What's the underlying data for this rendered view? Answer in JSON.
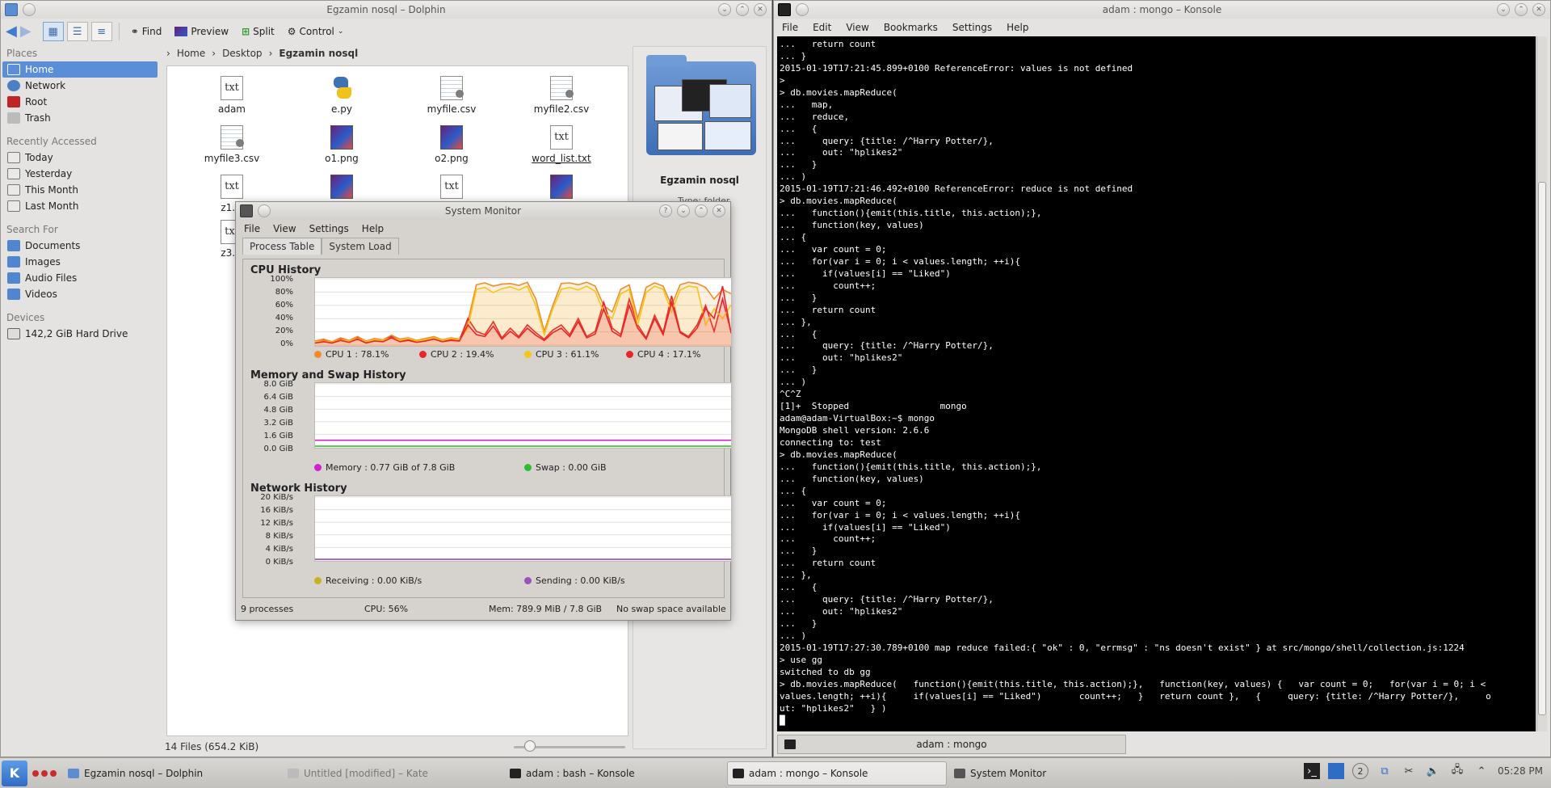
{
  "dolphin": {
    "title": "Egzamin nosql – Dolphin",
    "toolbar": {
      "find": "Find",
      "preview": "Preview",
      "split": "Split",
      "control": "Control"
    },
    "places_header": "Places",
    "places": [
      "Home",
      "Network",
      "Root",
      "Trash"
    ],
    "recent_header": "Recently Accessed",
    "recent": [
      "Today",
      "Yesterday",
      "This Month",
      "Last Month"
    ],
    "search_header": "Search For",
    "search": [
      "Documents",
      "Images",
      "Audio Files",
      "Videos"
    ],
    "devices_header": "Devices",
    "devices": [
      "142,2 GiB Hard Drive"
    ],
    "breadcrumb": [
      "Home",
      "Desktop",
      "Egzamin nosql"
    ],
    "files": [
      {
        "name": "adam",
        "type": "txt"
      },
      {
        "name": "e.py",
        "type": "py"
      },
      {
        "name": "myfile.csv",
        "type": "csv"
      },
      {
        "name": "myfile2.csv",
        "type": "csv"
      },
      {
        "name": "myfile3.csv",
        "type": "csv"
      },
      {
        "name": "o1.png",
        "type": "png"
      },
      {
        "name": "o2.png",
        "type": "png"
      },
      {
        "name": "word_list.txt",
        "type": "txt"
      },
      {
        "name": "z1.js",
        "type": "txt"
      },
      {
        "name": "",
        "type": "png"
      },
      {
        "name": "",
        "type": "txt"
      },
      {
        "name": "",
        "type": "png"
      },
      {
        "name": "z3.js",
        "type": "txt"
      }
    ],
    "info": {
      "name": "Egzamin nosql",
      "type_line": "Type: folder"
    },
    "status": "14 Files (654.2 KiB)"
  },
  "sysmon": {
    "title": "System Monitor",
    "menu": [
      "File",
      "View",
      "Settings",
      "Help"
    ],
    "tabs": [
      "Process Table",
      "System Load"
    ],
    "cpu": {
      "title": "CPU History",
      "yticks": [
        "100%",
        "80%",
        "60%",
        "40%",
        "20%",
        "0%"
      ],
      "legend": [
        {
          "label": "CPU 1 : 78.1%",
          "color": "#f28c28"
        },
        {
          "label": "CPU 2 : 19.4%",
          "color": "#e8262a"
        },
        {
          "label": "CPU 3 : 61.1%",
          "color": "#f5c518"
        },
        {
          "label": "CPU 4 : 17.1%",
          "color": "#e8262a"
        }
      ]
    },
    "mem": {
      "title": "Memory and Swap History",
      "yticks": [
        "8.0 GiB",
        "6.4 GiB",
        "4.8 GiB",
        "3.2 GiB",
        "1.6 GiB",
        "0.0 GiB"
      ],
      "legend": [
        {
          "label": "Memory : 0.77 GiB of 7.8 GiB",
          "color": "#d21fd2"
        },
        {
          "label": "Swap : 0.00 GiB",
          "color": "#2dbd2d"
        }
      ]
    },
    "net": {
      "title": "Network History",
      "yticks": [
        "20 KiB/s",
        "16 KiB/s",
        "12 KiB/s",
        "8 KiB/s",
        "4 KiB/s",
        "0 KiB/s"
      ],
      "legend": [
        {
          "label": "Receiving : 0.00 KiB/s",
          "color": "#c8b21e"
        },
        {
          "label": "Sending : 0.00 KiB/s",
          "color": "#9b4fc0"
        }
      ]
    },
    "status": {
      "processes": "9 processes",
      "cpu": "CPU: 56%",
      "mem": "Mem: 789.9 MiB / 7.8 GiB",
      "swap": "No swap space available"
    }
  },
  "chart_data": [
    {
      "type": "line",
      "title": "CPU History",
      "ylim": [
        0,
        100
      ],
      "x": [
        0,
        1,
        2,
        3,
        4,
        5,
        6,
        7,
        8,
        9,
        10,
        11,
        12,
        13,
        14,
        15,
        16,
        17,
        18,
        19,
        20,
        21,
        22,
        23,
        24,
        25,
        26,
        27,
        28,
        29,
        30,
        31,
        32,
        33,
        34,
        35,
        36,
        37,
        38,
        39,
        40,
        41,
        42,
        43,
        44,
        45,
        46,
        47,
        48,
        49
      ],
      "series": [
        {
          "name": "CPU 1 : 78.1%",
          "color": "#f28c28",
          "values": [
            5,
            8,
            4,
            10,
            6,
            12,
            5,
            9,
            7,
            14,
            8,
            10,
            6,
            9,
            12,
            7,
            10,
            8,
            35,
            92,
            95,
            90,
            93,
            94,
            91,
            96,
            70,
            20,
            60,
            94,
            95,
            92,
            96,
            90,
            60,
            50,
            85,
            92,
            40,
            88,
            95,
            90,
            60,
            92,
            96,
            94,
            88,
            70,
            85,
            78
          ]
        },
        {
          "name": "CPU 2 : 19.4%",
          "color": "#e8262a",
          "values": [
            3,
            6,
            2,
            8,
            4,
            10,
            3,
            6,
            5,
            12,
            5,
            8,
            4,
            6,
            10,
            5,
            8,
            6,
            40,
            20,
            15,
            35,
            10,
            25,
            12,
            30,
            18,
            8,
            22,
            30,
            15,
            40,
            12,
            20,
            65,
            25,
            15,
            70,
            30,
            10,
            45,
            18,
            75,
            20,
            12,
            30,
            60,
            20,
            70,
            19
          ]
        },
        {
          "name": "CPU 3 : 61.1%",
          "color": "#f5c518",
          "values": [
            4,
            5,
            3,
            7,
            5,
            9,
            4,
            7,
            6,
            10,
            6,
            9,
            5,
            7,
            10,
            6,
            9,
            7,
            25,
            85,
            88,
            80,
            86,
            89,
            84,
            90,
            60,
            15,
            55,
            85,
            88,
            84,
            90,
            82,
            50,
            40,
            78,
            85,
            30,
            80,
            90,
            85,
            50,
            84,
            90,
            88,
            30,
            55,
            40,
            61
          ]
        },
        {
          "name": "CPU 4 : 17.1%",
          "color": "#e8262a",
          "values": [
            2,
            4,
            2,
            6,
            3,
            8,
            2,
            5,
            4,
            10,
            4,
            6,
            3,
            5,
            8,
            4,
            6,
            5,
            30,
            15,
            12,
            28,
            8,
            20,
            10,
            25,
            14,
            6,
            18,
            25,
            12,
            35,
            10,
            16,
            55,
            20,
            12,
            60,
            25,
            8,
            40,
            15,
            65,
            18,
            10,
            25,
            55,
            40,
            90,
            17
          ]
        }
      ]
    },
    {
      "type": "line",
      "title": "Memory and Swap History",
      "ylim": [
        0,
        8
      ],
      "series": [
        {
          "name": "Memory : 0.77 GiB of 7.8 GiB",
          "color": "#d21fd2",
          "values": [
            0.77,
            0.77
          ]
        },
        {
          "name": "Swap : 0.00 GiB",
          "color": "#2dbd2d",
          "values": [
            0.0,
            0.0
          ]
        }
      ]
    },
    {
      "type": "line",
      "title": "Network History",
      "ylim": [
        0,
        20
      ],
      "series": [
        {
          "name": "Receiving : 0.00 KiB/s",
          "color": "#c8b21e",
          "values": [
            0.0,
            0.0
          ]
        },
        {
          "name": "Sending : 0.00 KiB/s",
          "color": "#9b4fc0",
          "values": [
            0.0,
            0.0
          ]
        }
      ]
    }
  ],
  "konsole": {
    "title": "adam : mongo – Konsole",
    "menu": [
      "File",
      "Edit",
      "View",
      "Bookmarks",
      "Settings",
      "Help"
    ],
    "lines": [
      "...   return count",
      "... }",
      "2015-01-19T17:21:45.899+0100 ReferenceError: values is not defined",
      ">",
      "> db.movies.mapReduce(",
      "...   map,",
      "...   reduce,",
      "...   {",
      "...     query: {title: /^Harry Potter/},",
      "...     out: \"hplikes2\"",
      "...   }",
      "... )",
      "2015-01-19T17:21:46.492+0100 ReferenceError: reduce is not defined",
      "> db.movies.mapReduce(",
      "...   function(){emit(this.title, this.action);},",
      "...   function(key, values)",
      "... {",
      "...   var count = 0;",
      "...   for(var i = 0; i < values.length; ++i){",
      "...     if(values[i] == \"Liked\")",
      "...       count++;",
      "...   }",
      "...   return count",
      "... },",
      "...   {",
      "...     query: {title: /^Harry Potter/},",
      "...     out: \"hplikes2\"",
      "...   }",
      "... )",
      "^C^Z",
      "[1]+  Stopped                 mongo",
      "adam@adam-VirtualBox:~$ mongo",
      "MongoDB shell version: 2.6.6",
      "connecting to: test",
      "> db.movies.mapReduce(",
      "...   function(){emit(this.title, this.action);},",
      "...   function(key, values)",
      "... {",
      "...   var count = 0;",
      "...   for(var i = 0; i < values.length; ++i){",
      "...     if(values[i] == \"Liked\")",
      "...       count++;",
      "...   }",
      "...   return count",
      "... },",
      "...   {",
      "...     query: {title: /^Harry Potter/},",
      "...     out: \"hplikes2\"",
      "...   }",
      "... )",
      "2015-01-19T17:27:30.789+0100 map reduce failed:{ \"ok\" : 0, \"errmsg\" : \"ns doesn't exist\" } at src/mongo/shell/collection.js:1224",
      "> use gg",
      "switched to db gg",
      "> db.movies.mapReduce(   function(){emit(this.title, this.action);},   function(key, values) {   var count = 0;   for(var i = 0; i <",
      "values.length; ++i){     if(values[i] == \"Liked\")       count++;   }   return count },   {     query: {title: /^Harry Potter/},     o",
      "ut: \"hplikes2\"   } )",
      "█"
    ],
    "tab": "adam : mongo"
  },
  "taskbar": {
    "tasks": [
      {
        "label": "Egzamin nosql – Dolphin",
        "state": "normal"
      },
      {
        "label": "Untitled [modified] – Kate",
        "state": "dim"
      },
      {
        "label": "adam : bash – Konsole",
        "state": "normal"
      },
      {
        "label": "adam : mongo – Konsole",
        "state": "active"
      },
      {
        "label": "System Monitor",
        "state": "normal"
      }
    ],
    "tray_badge": "2",
    "clock": "05:28 PM"
  }
}
